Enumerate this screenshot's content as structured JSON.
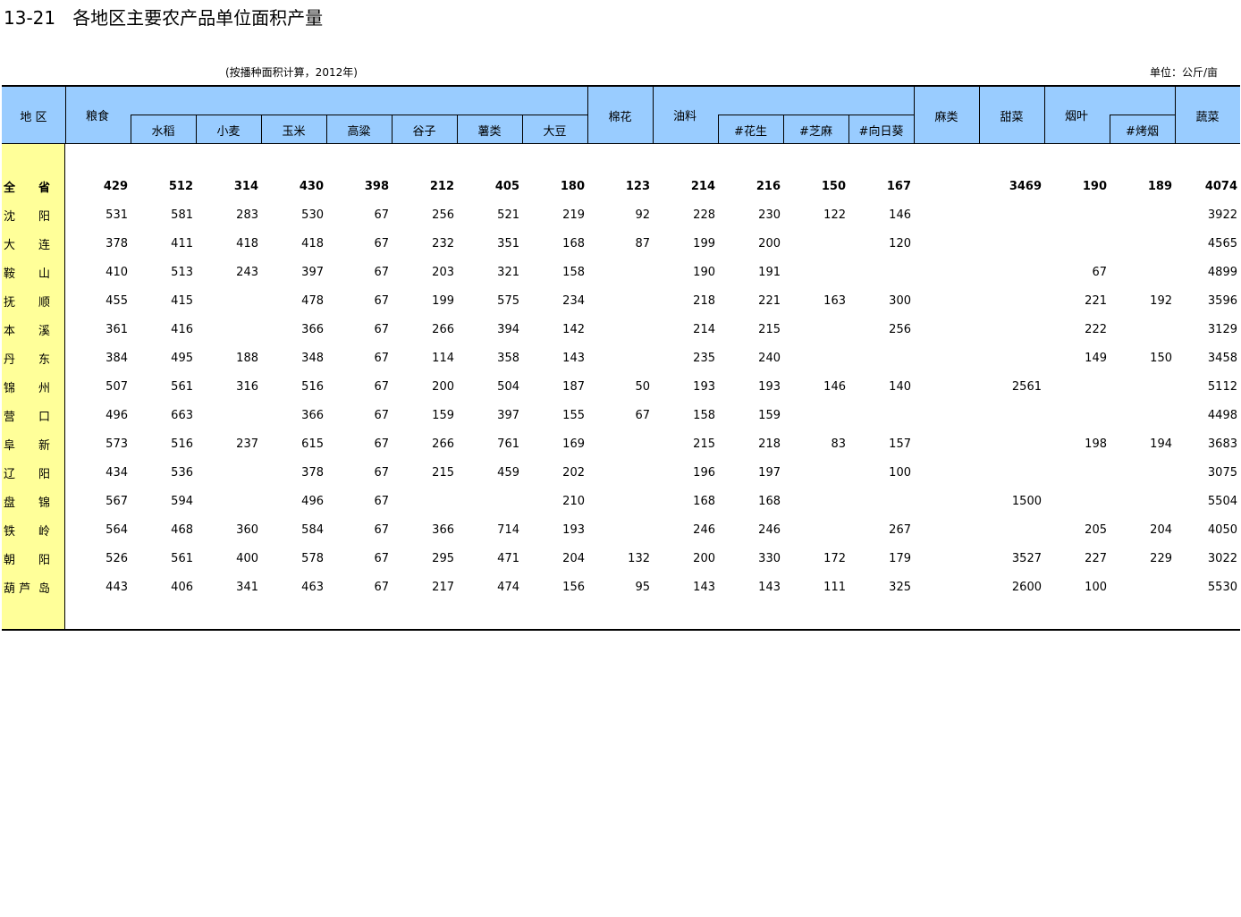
{
  "title": "13-21   各地区主要农产品单位面积产量",
  "subtitle": "(按播种面积计算，2012年)",
  "unit": "单位：公斤/亩",
  "headers": {
    "region": "地    区",
    "grain": "粮食",
    "rice": "水稻",
    "wheat": "小麦",
    "corn": "玉米",
    "sorghum": "高粱",
    "millet": "谷子",
    "tubers": "薯类",
    "soybean": "大豆",
    "cotton": "棉花",
    "oil": "油料",
    "peanut": "#花生",
    "sesame": "#芝麻",
    "sunflower": "#向日葵",
    "hemp": "麻类",
    "beet": "甜菜",
    "tobacco": "烟叶",
    "flue_tobacco": "#烤烟",
    "vegetables": "蔬菜"
  },
  "rows": [
    {
      "region": [
        "全",
        "省"
      ],
      "values": [
        "429",
        "512",
        "314",
        "430",
        "398",
        "212",
        "405",
        "180",
        "123",
        "214",
        "216",
        "150",
        "167",
        "",
        "3469",
        "190",
        "189",
        "4074"
      ]
    },
    {
      "region": [
        "沈",
        "阳"
      ],
      "values": [
        "531",
        "581",
        "283",
        "530",
        "67",
        "256",
        "521",
        "219",
        "92",
        "228",
        "230",
        "122",
        "146",
        "",
        "",
        "",
        "",
        "3922"
      ]
    },
    {
      "region": [
        "大",
        "连"
      ],
      "values": [
        "378",
        "411",
        "418",
        "418",
        "67",
        "232",
        "351",
        "168",
        "87",
        "199",
        "200",
        "",
        "120",
        "",
        "",
        "",
        "",
        "4565"
      ]
    },
    {
      "region": [
        "鞍",
        "山"
      ],
      "values": [
        "410",
        "513",
        "243",
        "397",
        "67",
        "203",
        "321",
        "158",
        "",
        "190",
        "191",
        "",
        "",
        "",
        "",
        "67",
        "",
        "4899"
      ]
    },
    {
      "region": [
        "抚",
        "顺"
      ],
      "values": [
        "455",
        "415",
        "",
        "478",
        "67",
        "199",
        "575",
        "234",
        "",
        "218",
        "221",
        "163",
        "300",
        "",
        "",
        "221",
        "192",
        "3596"
      ]
    },
    {
      "region": [
        "本",
        "溪"
      ],
      "values": [
        "361",
        "416",
        "",
        "366",
        "67",
        "266",
        "394",
        "142",
        "",
        "214",
        "215",
        "",
        "256",
        "",
        "",
        "222",
        "",
        "3129"
      ]
    },
    {
      "region": [
        "丹",
        "东"
      ],
      "values": [
        "384",
        "495",
        "188",
        "348",
        "67",
        "114",
        "358",
        "143",
        "",
        "235",
        "240",
        "",
        "",
        "",
        "",
        "149",
        "150",
        "3458"
      ]
    },
    {
      "region": [
        "锦",
        "州"
      ],
      "values": [
        "507",
        "561",
        "316",
        "516",
        "67",
        "200",
        "504",
        "187",
        "50",
        "193",
        "193",
        "146",
        "140",
        "",
        "2561",
        "",
        "",
        "5112"
      ]
    },
    {
      "region": [
        "营",
        "口"
      ],
      "values": [
        "496",
        "663",
        "",
        "366",
        "67",
        "159",
        "397",
        "155",
        "67",
        "158",
        "159",
        "",
        "",
        "",
        "",
        "",
        "",
        "4498"
      ]
    },
    {
      "region": [
        "阜",
        "新"
      ],
      "values": [
        "573",
        "516",
        "237",
        "615",
        "67",
        "266",
        "761",
        "169",
        "",
        "215",
        "218",
        "83",
        "157",
        "",
        "",
        "198",
        "194",
        "3683"
      ]
    },
    {
      "region": [
        "辽",
        "阳"
      ],
      "values": [
        "434",
        "536",
        "",
        "378",
        "67",
        "215",
        "459",
        "202",
        "",
        "196",
        "197",
        "",
        "100",
        "",
        "",
        "",
        "",
        "3075"
      ]
    },
    {
      "region": [
        "盘",
        "锦"
      ],
      "values": [
        "567",
        "594",
        "",
        "496",
        "67",
        "",
        "",
        "210",
        "",
        "168",
        "168",
        "",
        "",
        "",
        "1500",
        "",
        "",
        "5504"
      ]
    },
    {
      "region": [
        "铁",
        "岭"
      ],
      "values": [
        "564",
        "468",
        "360",
        "584",
        "67",
        "366",
        "714",
        "193",
        "",
        "246",
        "246",
        "",
        "267",
        "",
        "",
        "205",
        "204",
        "4050"
      ]
    },
    {
      "region": [
        "朝",
        "阳"
      ],
      "values": [
        "526",
        "561",
        "400",
        "578",
        "67",
        "295",
        "471",
        "204",
        "132",
        "200",
        "330",
        "172",
        "179",
        "",
        "3527",
        "227",
        "229",
        "3022"
      ]
    },
    {
      "region": [
        "葫 芦",
        "岛"
      ],
      "values": [
        "443",
        "406",
        "341",
        "463",
        "67",
        "217",
        "474",
        "156",
        "95",
        "143",
        "143",
        "111",
        "325",
        "",
        "2600",
        "100",
        "",
        "5530"
      ]
    }
  ]
}
